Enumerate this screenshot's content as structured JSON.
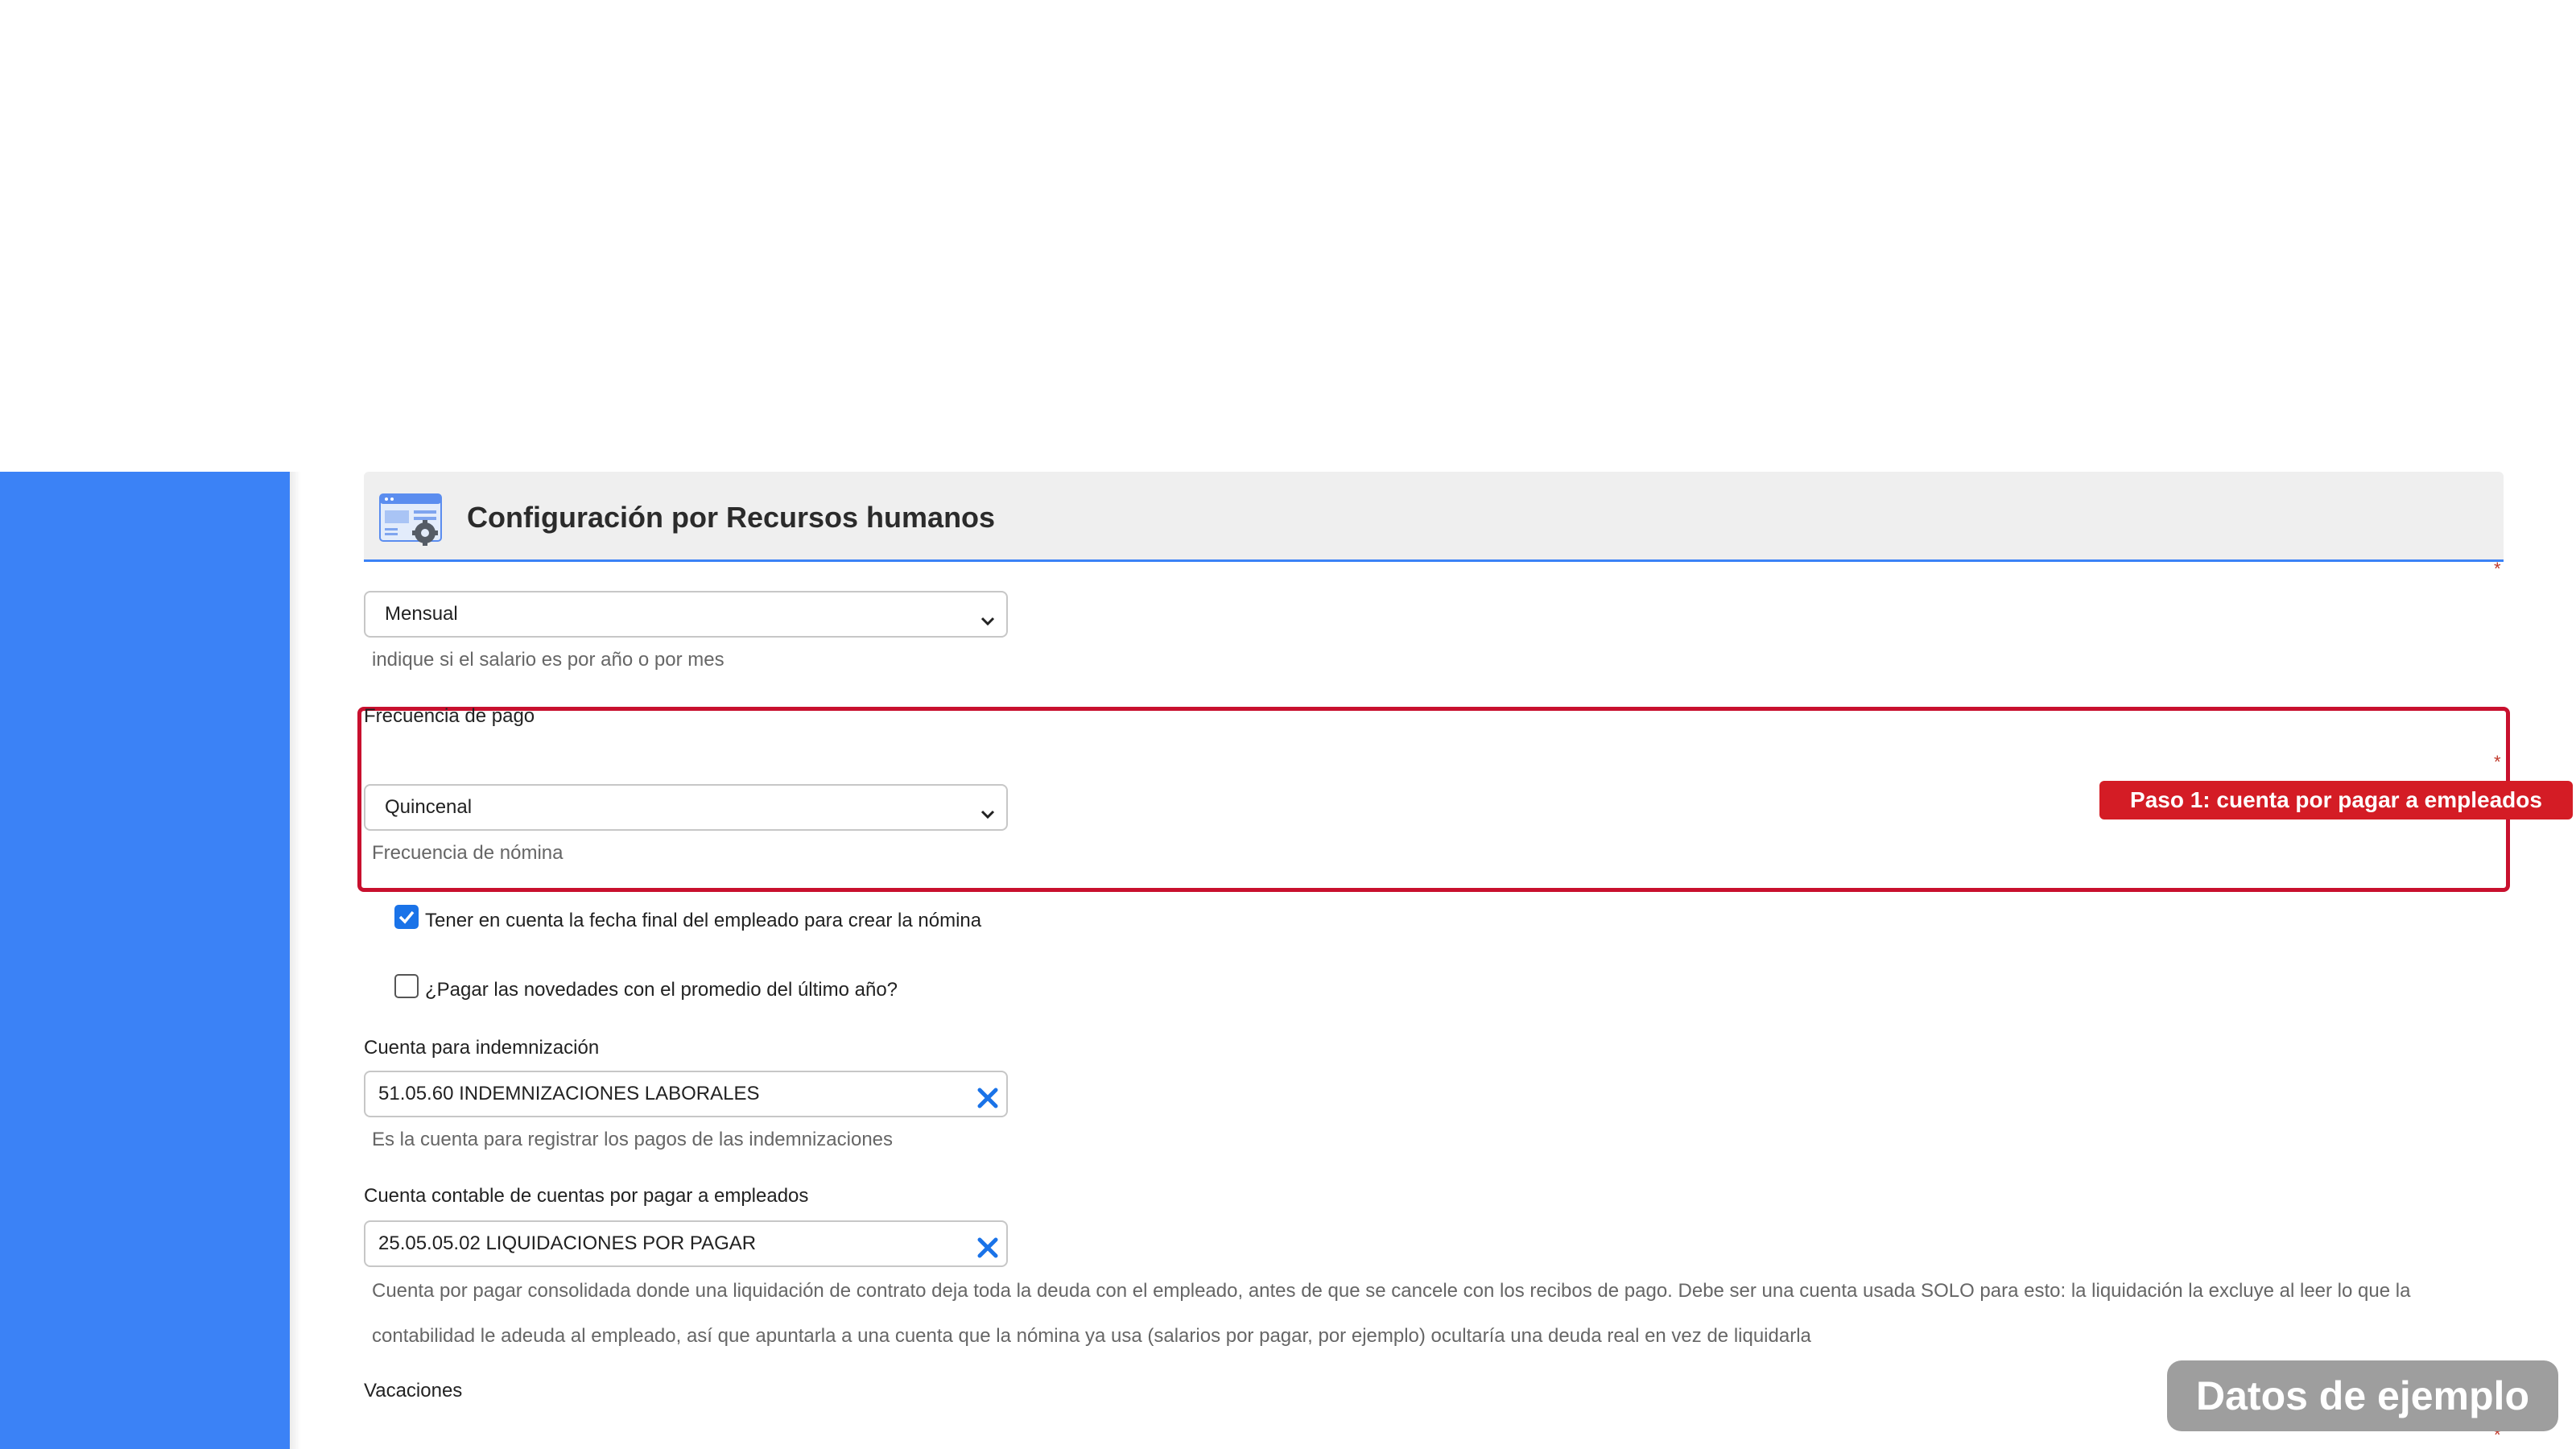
{
  "header": {
    "title": "Configuración por Recursos humanos",
    "icon": "settings-window-icon"
  },
  "salary_type": {
    "selected": "Mensual",
    "help": "indique si el salario es por año o por mes"
  },
  "payment_frequency": {
    "label": "Frecuencia de pago",
    "selected": "Quincenal",
    "help": "Frecuencia de nómina"
  },
  "step_badge": {
    "text": "Paso 1: cuenta por pagar a empleados",
    "color": "#d41c25"
  },
  "checkboxes": [
    {
      "label": "Tener en cuenta la fecha final del empleado para crear la nómina",
      "checked": true
    },
    {
      "label": "¿Pagar las novedades con el promedio del último año?",
      "checked": false
    }
  ],
  "indemnity_account": {
    "label": "Cuenta para indemnización",
    "value": "51.05.60 INDEMNIZACIONES LABORALES",
    "help": "Es la cuenta para registrar los pagos de las indemnizaciones"
  },
  "employee_payable_account": {
    "label": "Cuenta contable de cuentas por pagar a empleados",
    "value": "25.05.05.02 LIQUIDACIONES POR PAGAR",
    "help": "Cuenta por pagar consolidada donde una liquidación de contrato deja toda la deuda con el empleado, antes de que se cancele con los recibos de pago. Debe ser una cuenta usada SOLO para esto: la liquidación la excluye al leer lo que la contabilidad le adeuda al empleado, así que apuntarla a una cuenta que la nómina ya usa (salarios por pagar, por ejemplo) ocultaría una deuda real en vez de liquidarla"
  },
  "vacations": {
    "label": "Vacaciones"
  },
  "sample_badge": {
    "text": "Datos de ejemplo"
  },
  "required_mark": "*",
  "colors": {
    "sidebar": "#3b82f6",
    "accent": "#1a73e8",
    "highlight_border": "#c8102e"
  }
}
